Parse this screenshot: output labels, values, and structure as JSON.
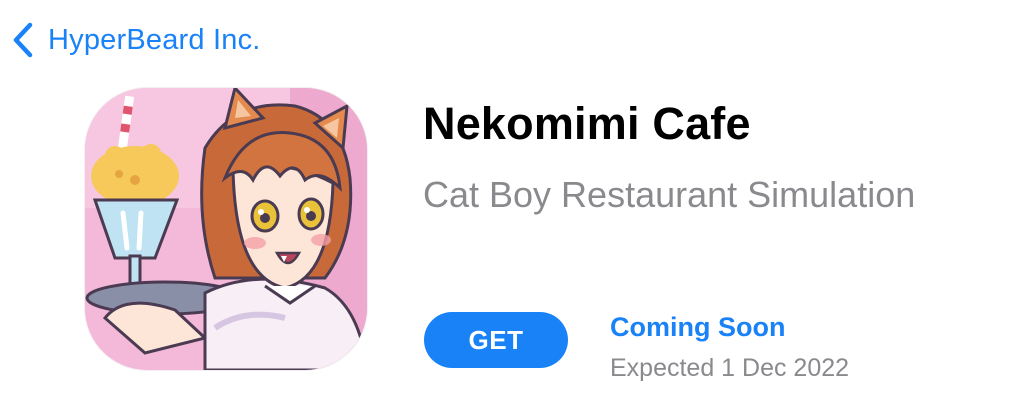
{
  "header": {
    "back_label": "HyperBeard Inc.",
    "back_icon": "chevron-left-icon"
  },
  "app": {
    "title": "Nekomimi Cafe",
    "subtitle": "Cat Boy Restaurant Simulation",
    "icon": "app-icon-cat-boy-waiter"
  },
  "actions": {
    "get_label": "GET",
    "status_label": "Coming Soon",
    "expected_label": "Expected 1 Dec 2022"
  },
  "colors": {
    "accent": "#1a82f7",
    "secondary_text": "#8a8a8e",
    "primary_text": "#000000",
    "icon_background": "#f4b8d8"
  }
}
